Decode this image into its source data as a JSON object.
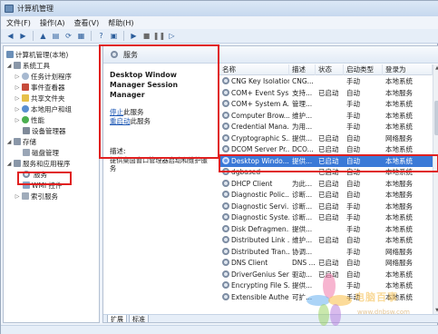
{
  "window": {
    "title": "计算机管理"
  },
  "menu": [
    "文件(F)",
    "操作(A)",
    "查看(V)",
    "帮助(H)"
  ],
  "toolbar_icons": [
    "back-icon",
    "forward-icon",
    "up-folder-icon",
    "show-hide-tree-icon",
    "refresh-icon",
    "export-list-icon",
    "help-icon",
    "properties-icon",
    "play-icon",
    "stop-icon",
    "pause-icon",
    "restart-icon"
  ],
  "tree": {
    "root": "计算机管理(本地)",
    "system_tools": "系统工具",
    "task_scheduler": "任务计划程序",
    "event_viewer": "事件查看器",
    "shared_folders": "共享文件夹",
    "local_users": "本地用户和组",
    "performance": "性能",
    "device_manager": "设备管理器",
    "storage": "存储",
    "disk_management": "磁盘管理",
    "services_apps": "服务和应用程序",
    "services": "服务",
    "wmi": "WMI 控件",
    "index": "索引服务"
  },
  "services_panel": {
    "header": "服务",
    "selected_name": "Desktop Window Manager Session Manager",
    "stop_link": "停止",
    "stop_suffix": "此服务",
    "restart_link": "重启动",
    "restart_suffix": "此服务",
    "desc_label": "描述:",
    "desc_text": "提供桌面窗口管理器启动和维护服务"
  },
  "columns": [
    "名称",
    "描述",
    "状态",
    "启动类型",
    "登录为"
  ],
  "rows": [
    {
      "name": "CNG Key Isolation",
      "desc": "CNG...",
      "status": "",
      "startup": "手动",
      "logon": "本地系统"
    },
    {
      "name": "COM+ Event Sys...",
      "desc": "支持...",
      "status": "已启动",
      "startup": "自动",
      "logon": "本地服务"
    },
    {
      "name": "COM+ System A...",
      "desc": "管理...",
      "status": "",
      "startup": "手动",
      "logon": "本地系统"
    },
    {
      "name": "Computer Brow...",
      "desc": "维护...",
      "status": "",
      "startup": "手动",
      "logon": "本地系统"
    },
    {
      "name": "Credential Mana...",
      "desc": "为用...",
      "status": "",
      "startup": "手动",
      "logon": "本地系统"
    },
    {
      "name": "Cryptographic S...",
      "desc": "提供...",
      "status": "已启动",
      "startup": "自动",
      "logon": "网络服务"
    },
    {
      "name": "DCOM Server Pr...",
      "desc": "DCO...",
      "status": "已启动",
      "startup": "自动",
      "logon": "本地系统"
    },
    {
      "name": "Desktop Windo...",
      "desc": "提供...",
      "status": "已启动",
      "startup": "自动",
      "logon": "本地系统"
    },
    {
      "name": "dgbased",
      "desc": "",
      "status": "已启动",
      "startup": "自动",
      "logon": "本地系统"
    },
    {
      "name": "DHCP Client",
      "desc": "为此...",
      "status": "已启动",
      "startup": "自动",
      "logon": "本地服务"
    },
    {
      "name": "Diagnostic Polic...",
      "desc": "诊断...",
      "status": "已启动",
      "startup": "自动",
      "logon": "本地服务"
    },
    {
      "name": "Diagnostic Servi...",
      "desc": "诊断...",
      "status": "已启动",
      "startup": "手动",
      "logon": "本地服务"
    },
    {
      "name": "Diagnostic Syste...",
      "desc": "诊断...",
      "status": "已启动",
      "startup": "手动",
      "logon": "本地系统"
    },
    {
      "name": "Disk Defragmen...",
      "desc": "提供...",
      "status": "",
      "startup": "手动",
      "logon": "本地系统"
    },
    {
      "name": "Distributed Link ...",
      "desc": "维护...",
      "status": "已启动",
      "startup": "自动",
      "logon": "本地系统"
    },
    {
      "name": "Distributed Tran...",
      "desc": "协调...",
      "status": "",
      "startup": "手动",
      "logon": "网络服务"
    },
    {
      "name": "DNS Client",
      "desc": "DNS ...",
      "status": "已启动",
      "startup": "自动",
      "logon": "网络服务"
    },
    {
      "name": "DriverGenius Ser...",
      "desc": "驱动...",
      "status": "已启动",
      "startup": "自动",
      "logon": "本地系统"
    },
    {
      "name": "Encrypting File S...",
      "desc": "提供...",
      "status": "",
      "startup": "手动",
      "logon": "本地系统"
    },
    {
      "name": "Extensible Authe...",
      "desc": "可扩...",
      "status": "",
      "startup": "手动",
      "logon": "本地系统"
    }
  ],
  "selected_row": 7,
  "tabs": [
    "扩展",
    "标准"
  ],
  "watermark": {
    "text": "电脑百事",
    "url": "www.dnbsw.com"
  },
  "colors": {
    "selection": "#3b79d7",
    "highlight_box": "#e02020",
    "link": "#1a55b3"
  }
}
